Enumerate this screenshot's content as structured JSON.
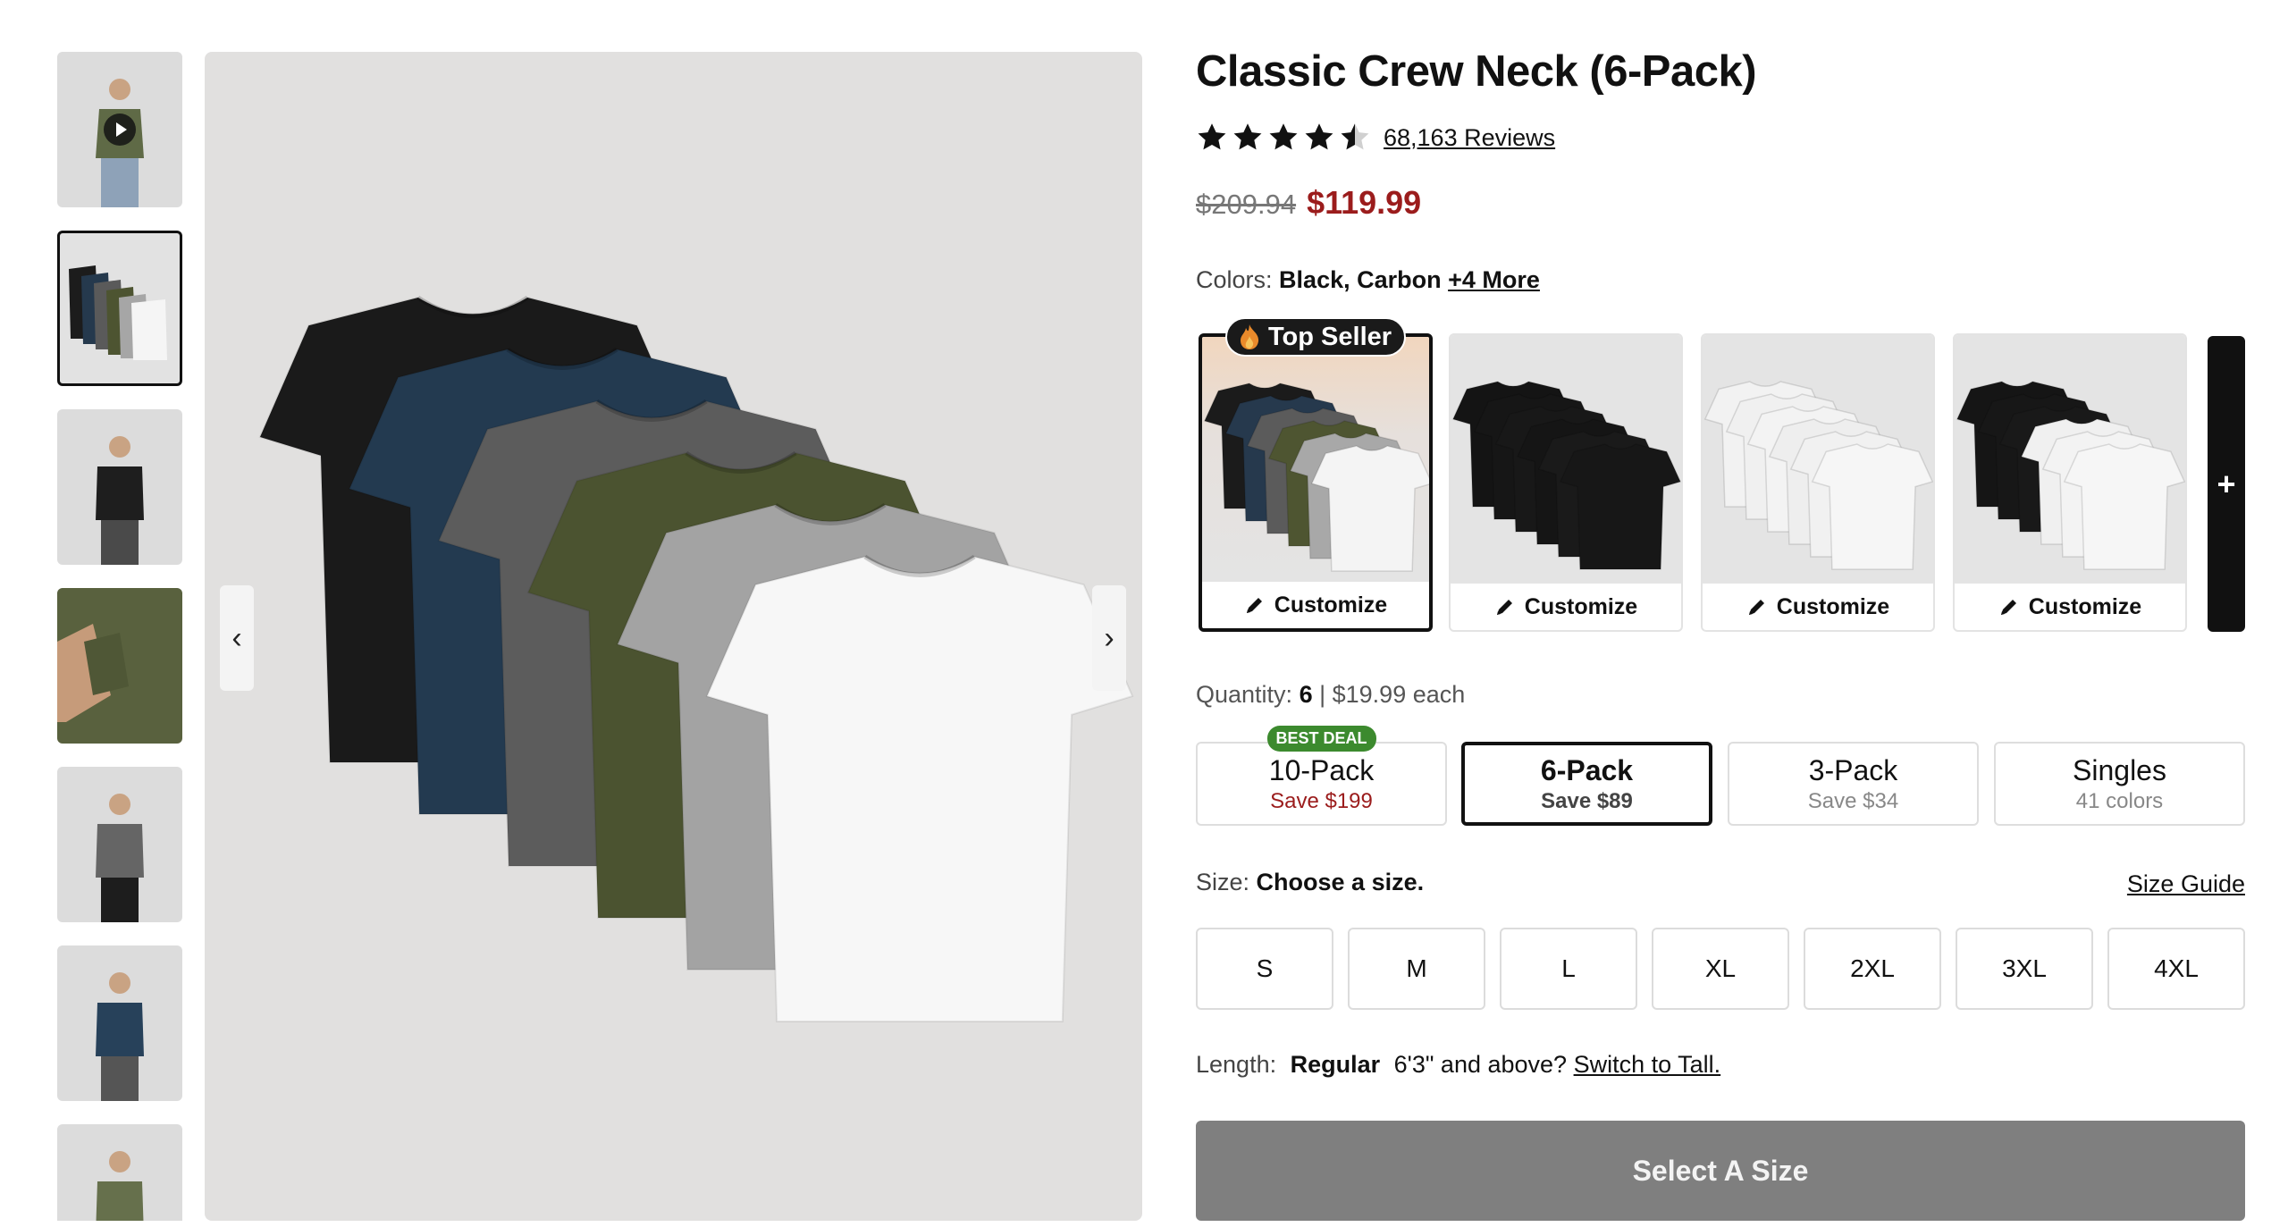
{
  "product": {
    "title": "Classic Crew Neck (6-Pack)",
    "rating": 4.5,
    "reviews_label": "68,163 Reviews",
    "price_original": "$209.94",
    "price_sale": "$119.99"
  },
  "colors": {
    "label": "Colors:",
    "value": "Black, Carbon",
    "more": "+4 More",
    "top_seller_badge": "Top Seller",
    "customize_label": "Customize",
    "add_icon": "+",
    "swatches": [
      {
        "name": "multi-pack",
        "shirts": [
          "#1b1b1b",
          "#26394d",
          "#5b5b5b",
          "#4e5531",
          "#a8a8a8",
          "#f4f4f4"
        ]
      },
      {
        "name": "black-pack",
        "shirts": [
          "#141414",
          "#161616",
          "#181818",
          "#151515",
          "#1a1a1a",
          "#171717"
        ]
      },
      {
        "name": "white-pack",
        "shirts": [
          "#f2f2f2",
          "#f0f0f0",
          "#f3f3f3",
          "#eeeeee",
          "#f1f1f1",
          "#f6f6f6"
        ]
      },
      {
        "name": "black-white-pack",
        "shirts": [
          "#151515",
          "#171717",
          "#191919",
          "#f0f0f0",
          "#f3f3f3",
          "#f6f6f6"
        ]
      }
    ]
  },
  "quantity": {
    "label": "Quantity:",
    "value": "6",
    "each": " | $19.99 each"
  },
  "packs": [
    {
      "label": "10-Pack",
      "sub": "Save $199",
      "badge": "BEST DEAL"
    },
    {
      "label": "6-Pack",
      "sub": "Save $89"
    },
    {
      "label": "3-Pack",
      "sub": "Save $34"
    },
    {
      "label": "Singles",
      "sub": "41 colors"
    }
  ],
  "size": {
    "label": "Size:",
    "prompt": "Choose a size.",
    "guide": "Size Guide",
    "options": [
      "S",
      "M",
      "L",
      "XL",
      "2XL",
      "3XL",
      "4XL"
    ]
  },
  "length": {
    "label": "Length:",
    "value": "Regular",
    "question": "6'3\" and above?",
    "switch": "Switch to Tall."
  },
  "cta": {
    "label": "Select A Size"
  },
  "gallery": {
    "prev_icon": "‹",
    "next_icon": "›",
    "main_shirts": [
      "#1a1a1a",
      "#233a50",
      "#5c5c5c",
      "#4b5330",
      "#a3a3a3",
      "#f7f7f7"
    ],
    "thumb_colors": [
      "#5f6a46",
      "#2b2b2b",
      "#1e1e1e",
      "#59613e",
      "#656565",
      "#27415a",
      "#66704c"
    ]
  },
  "colors_theme": {
    "accent_red": "#9b1c1c",
    "best_deal_green": "#3c8a2e",
    "cta_gray": "#7f7f7f"
  }
}
